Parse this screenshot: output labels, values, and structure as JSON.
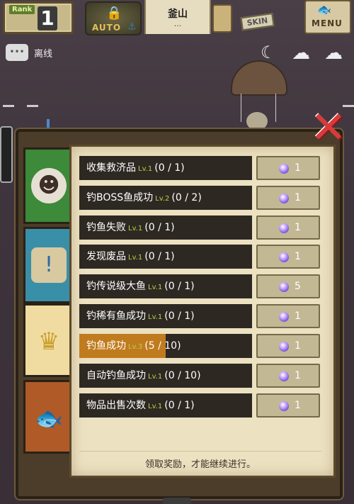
{
  "hud": {
    "rank_label": "Rank",
    "rank_value": "1",
    "auto_label": "AUTO",
    "location_name": "釜山",
    "location_sub": "...",
    "skin_label": "SKIN",
    "menu_label": "MENU"
  },
  "status": {
    "text": "离线"
  },
  "quests": [
    {
      "name": "收集救济品",
      "level": "Lv.1",
      "progress": "(0 / 1)",
      "fill": 0,
      "reward": "1"
    },
    {
      "name": "钓BOSS鱼成功",
      "level": "Lv.2",
      "progress": "(0 / 2)",
      "fill": 0,
      "reward": "1"
    },
    {
      "name": "钓鱼失败",
      "level": "Lv.1",
      "progress": "(0 / 1)",
      "fill": 0,
      "reward": "1"
    },
    {
      "name": "发现废品",
      "level": "Lv.1",
      "progress": "(0 / 1)",
      "fill": 0,
      "reward": "1"
    },
    {
      "name": "钓传说级大鱼",
      "level": "Lv.1",
      "progress": "(0 / 1)",
      "fill": 0,
      "reward": "5"
    },
    {
      "name": "钓稀有鱼成功",
      "level": "Lv.1",
      "progress": "(0 / 1)",
      "fill": 0,
      "reward": "1"
    },
    {
      "name": "钓鱼成功",
      "level": "Lv.3",
      "progress": "(5 / 10)",
      "fill": 0.5,
      "reward": "1"
    },
    {
      "name": "自动钓鱼成功",
      "level": "Lv.1",
      "progress": "(0 / 10)",
      "fill": 0,
      "reward": "1"
    },
    {
      "name": "物品出售次数",
      "level": "Lv.1",
      "progress": "(0 / 1)",
      "fill": 0,
      "reward": "1"
    }
  ],
  "footer": {
    "text": "领取奖励，才能继续进行。"
  },
  "colors": {
    "fill": "#c07b1e",
    "level": "#b6d24a",
    "close": "#d93a3a"
  }
}
